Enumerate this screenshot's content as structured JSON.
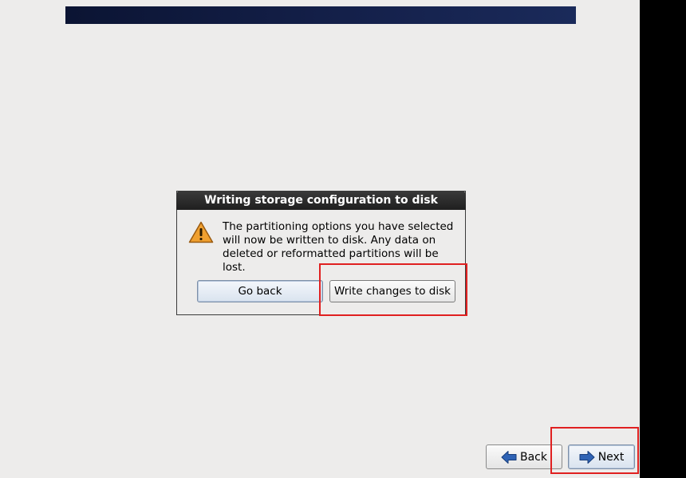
{
  "dialog": {
    "title": "Writing storage configuration to disk",
    "message": "The partitioning options you have selected will now be written to disk.  Any data on deleted or reformatted partitions will be lost.",
    "go_back_label": "Go back",
    "write_label": "Write changes to disk",
    "icon": "warning-icon"
  },
  "nav": {
    "back_label": "Back",
    "next_label": "Next",
    "back_icon": "arrow-left-icon",
    "next_icon": "arrow-right-icon"
  },
  "colors": {
    "banner": "#0b1433",
    "background": "#edeceb",
    "highlight": "#e02020",
    "title_bar": "#2b2b2b"
  }
}
